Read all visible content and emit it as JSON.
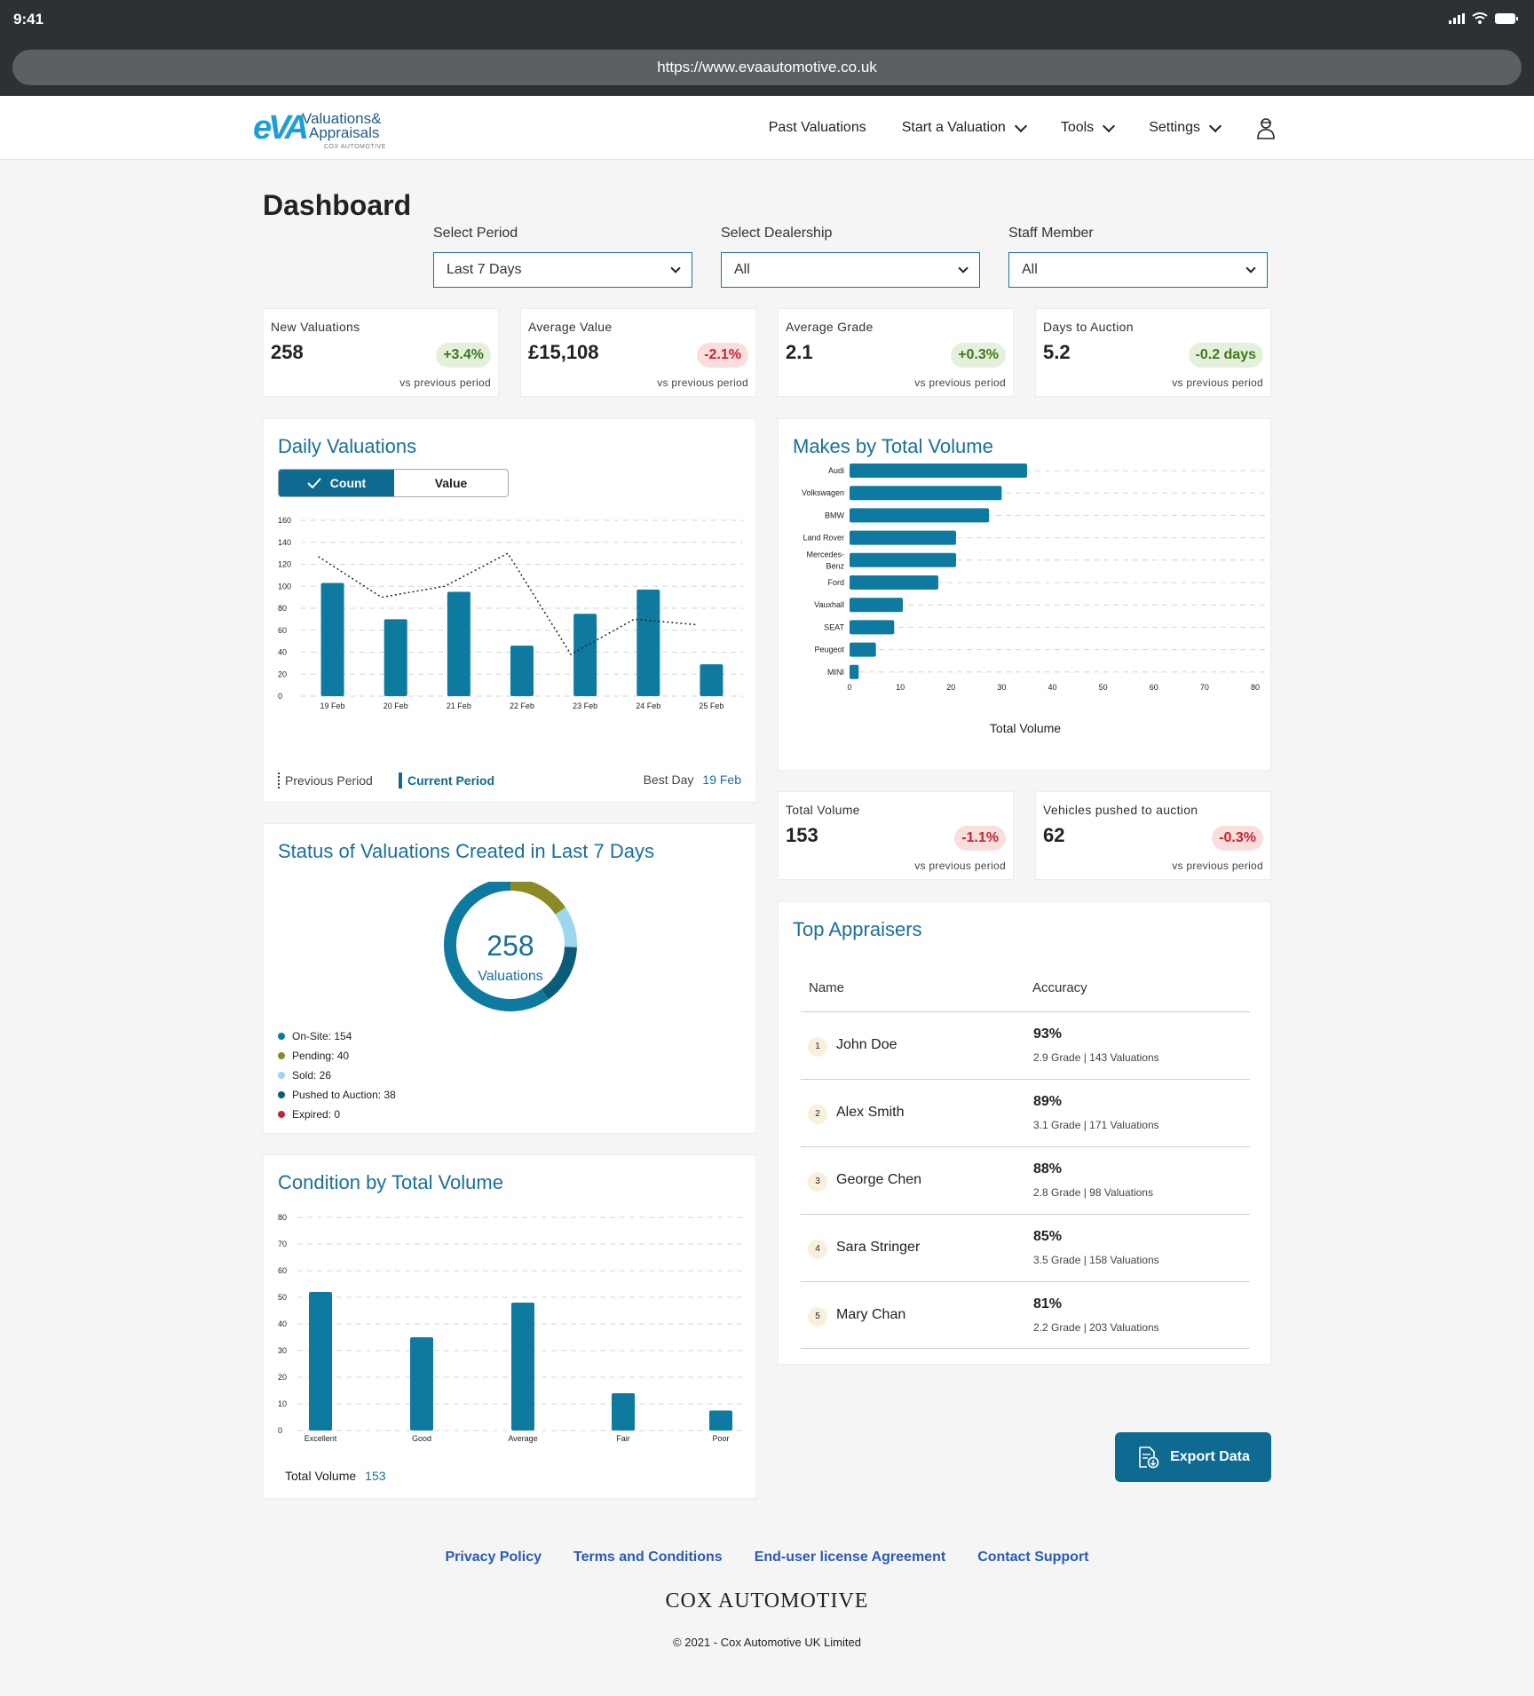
{
  "status_bar": {
    "time": "9:41"
  },
  "browser": {
    "url": "https://www.evaautomotive.co.uk"
  },
  "logo": {
    "mark": "eVA",
    "line1": "Valuations&",
    "line2": "Appraisals",
    "sub": "COX AUTOMOTIVE"
  },
  "nav": {
    "past_valuations": "Past Valuations",
    "start_valuation": "Start a Valuation",
    "tools": "Tools",
    "settings": "Settings"
  },
  "page_title": "Dashboard",
  "filters": {
    "period": {
      "label": "Select Period",
      "value": "Last 7 Days"
    },
    "dealership": {
      "label": "Select Dealership",
      "value": "All"
    },
    "staff": {
      "label": "Staff Member",
      "value": "All"
    }
  },
  "kpis": [
    {
      "label": "New Valuations",
      "value": "258",
      "change": "+3.4%",
      "trend": "positive",
      "sub": "vs previous period"
    },
    {
      "label": "Average Value",
      "value": "£15,108",
      "change": "-2.1%",
      "trend": "negative",
      "sub": "vs previous period"
    },
    {
      "label": "Average Grade",
      "value": "2.1",
      "change": "+0.3%",
      "trend": "positive",
      "sub": "vs previous period"
    },
    {
      "label": "Days to Auction",
      "value": "5.2",
      "change": "-0.2 days",
      "trend": "positive",
      "sub": "vs previous period"
    }
  ],
  "kpis2": [
    {
      "label": "Total Volume",
      "value": "153",
      "change": "-1.1%",
      "trend": "negative",
      "sub": "vs previous period"
    },
    {
      "label": "Vehicles pushed to auction",
      "value": "62",
      "change": "-0.3%",
      "trend": "negative",
      "sub": "vs previous period"
    }
  ],
  "daily": {
    "title": "Daily Valuations",
    "toggle_count": "Count",
    "toggle_value": "Value",
    "legend_previous": "Previous Period",
    "legend_current": "Current Period",
    "best_day_label": "Best Day",
    "best_day_value": "19 Feb"
  },
  "makes": {
    "title": "Makes by Total Volume"
  },
  "status": {
    "title": "Status of Valuations Created in Last 7 Days",
    "total": "258",
    "total_label": "Valuations",
    "legend": [
      {
        "label": "On-Site: 154",
        "color": "#0e7aa0"
      },
      {
        "label": "Pending: 40",
        "color": "#8c8a24"
      },
      {
        "label": "Sold: 26",
        "color": "#9dd6f0"
      },
      {
        "label": "Pushed to Auction: 38",
        "color": "#0b5c7a"
      },
      {
        "label": "Expired: 0",
        "color": "#c8242d"
      }
    ]
  },
  "condition": {
    "title": "Condition by Total Volume",
    "total_label": "Total Volume",
    "total_value": "153"
  },
  "appraisers": {
    "title": "Top Appraisers",
    "col_name": "Name",
    "col_accuracy": "Accuracy",
    "rows": [
      {
        "rank": "1",
        "name": "John Doe",
        "accuracy": "93%",
        "detail": "2.9 Grade | 143 Valuations"
      },
      {
        "rank": "2",
        "name": "Alex Smith",
        "accuracy": "89%",
        "detail": "3.1 Grade | 171 Valuations"
      },
      {
        "rank": "3",
        "name": "George Chen",
        "accuracy": "88%",
        "detail": "2.8 Grade | 98 Valuations"
      },
      {
        "rank": "4",
        "name": "Sara Stringer",
        "accuracy": "85%",
        "detail": "3.5 Grade | 158 Valuations"
      },
      {
        "rank": "5",
        "name": "Mary Chan",
        "accuracy": "81%",
        "detail": "2.2 Grade | 203 Valuations"
      }
    ]
  },
  "export_label": "Export Data",
  "footer": {
    "privacy": "Privacy Policy",
    "terms": "Terms and Conditions",
    "eula": "End-user license Agreement",
    "support": "Contact Support",
    "brand": "COX AUTOMOTIVE",
    "copyright": "© 2021 - Cox Automotive UK Limited"
  },
  "colors": {
    "primary": "#0e6a91",
    "bar": "#0e7aa0",
    "title": "#1a6f9a",
    "positive": "#3b7a1c",
    "negative": "#c8242d"
  },
  "chart_data": [
    {
      "id": "daily",
      "type": "bar",
      "categories": [
        "19 Feb",
        "20 Feb",
        "21 Feb",
        "22 Feb",
        "23 Feb",
        "24 Feb",
        "25 Feb"
      ],
      "series": [
        {
          "name": "Current Period",
          "type": "bar",
          "values": [
            103,
            70,
            95,
            46,
            75,
            97,
            29
          ]
        },
        {
          "name": "Previous Period",
          "type": "line",
          "style": "dotted",
          "values": [
            127,
            90,
            100,
            130,
            38,
            70,
            65
          ]
        }
      ],
      "ylim": [
        0,
        160
      ],
      "yticks": [
        0,
        20,
        40,
        60,
        80,
        100,
        120,
        140,
        160
      ]
    },
    {
      "id": "makes",
      "type": "bar",
      "orientation": "horizontal",
      "categories": [
        "Audi",
        "Volkswagen",
        "BMW",
        "Land Rover",
        "Mercedes-Benz",
        "Ford",
        "Vauxhall",
        "SEAT",
        "Peugeot",
        "MINI"
      ],
      "category_lines": [
        [
          "Audi"
        ],
        [
          "Volkswagen"
        ],
        [
          "BMW"
        ],
        [
          "Land Rover"
        ],
        [
          "Mercedes-",
          "Benz"
        ],
        [
          "Ford"
        ],
        [
          "Vauxhall"
        ],
        [
          "SEAT"
        ],
        [
          "Peugeot"
        ],
        [
          "MINI"
        ]
      ],
      "values": [
        35,
        30,
        27.5,
        21,
        21,
        17.5,
        10.5,
        8.8,
        5.2,
        1.8
      ],
      "xlabel": "Total Volume",
      "xlim": [
        0,
        80
      ],
      "xticks": [
        0,
        10,
        20,
        30,
        40,
        50,
        60,
        70,
        80
      ]
    },
    {
      "id": "status",
      "type": "pie",
      "donut": true,
      "categories": [
        "On-Site",
        "Pending",
        "Sold",
        "Pushed to Auction",
        "Expired"
      ],
      "values": [
        154,
        40,
        26,
        38,
        0
      ]
    },
    {
      "id": "condition",
      "type": "bar",
      "categories": [
        "Excellent",
        "Good",
        "Average",
        "Fair",
        "Poor"
      ],
      "values": [
        52,
        35,
        48,
        14,
        7.5
      ],
      "ylim": [
        0,
        80
      ],
      "yticks": [
        0,
        10,
        20,
        30,
        40,
        50,
        60,
        70,
        80
      ]
    }
  ]
}
